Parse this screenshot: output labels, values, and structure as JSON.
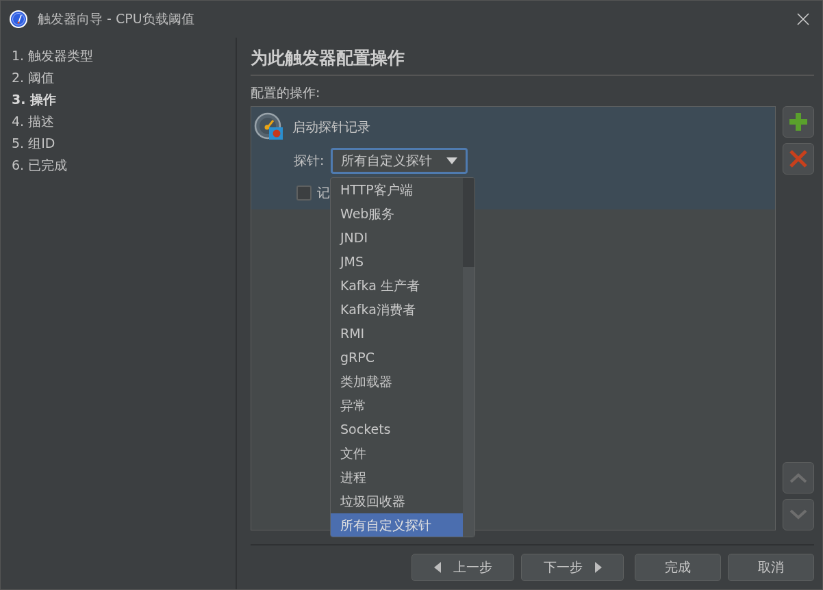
{
  "window": {
    "title": "触发器向导 - CPU负载阈值"
  },
  "steps": [
    {
      "label": "1. 触发器类型",
      "selected": false
    },
    {
      "label": "2. 阈值",
      "selected": false
    },
    {
      "label": "3. 操作",
      "selected": true
    },
    {
      "label": "4. 描述",
      "selected": false
    },
    {
      "label": "5. 组ID",
      "selected": false
    },
    {
      "label": "6. 已完成",
      "selected": false
    }
  ],
  "heading": "为此触发器配置操作",
  "actions_label": "配置的操作:",
  "actions": [
    {
      "title": "启动探针记录",
      "selected": true,
      "probe_label": "探针:",
      "probe_value": "所有自定义探针",
      "checkbox": {
        "label": "记",
        "checked": false
      }
    }
  ],
  "dropdown": {
    "options": [
      {
        "label": "HTTP客户端",
        "selected": false
      },
      {
        "label": "Web服务",
        "selected": false
      },
      {
        "label": "JNDI",
        "selected": false
      },
      {
        "label": "JMS",
        "selected": false
      },
      {
        "label": "Kafka 生产者",
        "selected": false
      },
      {
        "label": "Kafka消费者",
        "selected": false
      },
      {
        "label": "RMI",
        "selected": false
      },
      {
        "label": "gRPC",
        "selected": false
      },
      {
        "label": "类加载器",
        "selected": false
      },
      {
        "label": "异常",
        "selected": false
      },
      {
        "label": "Sockets",
        "selected": false
      },
      {
        "label": "文件",
        "selected": false
      },
      {
        "label": "进程",
        "selected": false
      },
      {
        "label": "垃圾回收器",
        "selected": false
      },
      {
        "label": "所有自定义探针",
        "selected": true
      }
    ]
  },
  "buttons": {
    "back": "上一步",
    "next": "下一步",
    "finish": "完成",
    "cancel": "取消"
  }
}
